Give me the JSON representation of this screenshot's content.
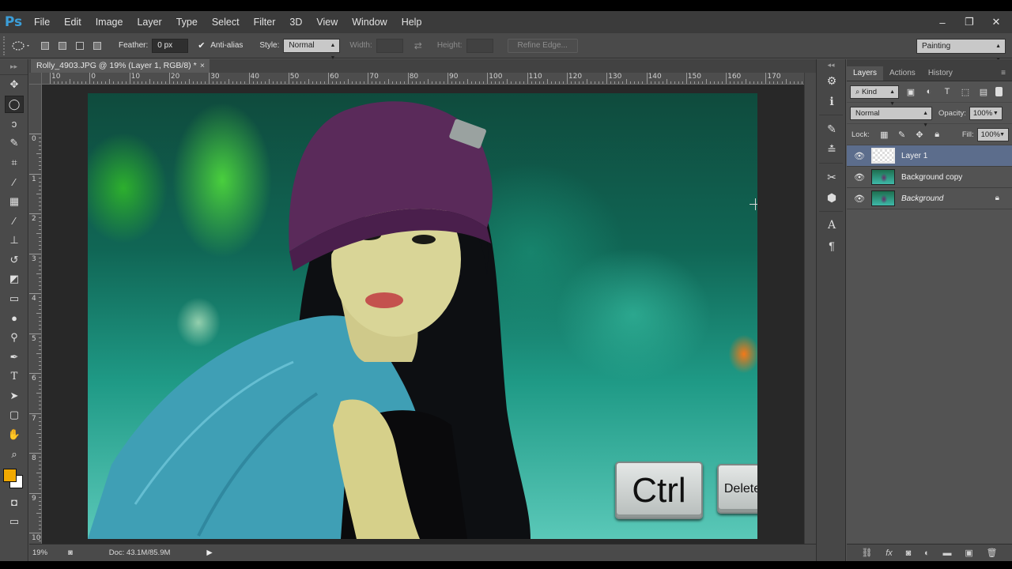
{
  "app": {
    "logo": "Ps",
    "menu": [
      "File",
      "Edit",
      "Image",
      "Layer",
      "Type",
      "Select",
      "Filter",
      "3D",
      "View",
      "Window",
      "Help"
    ],
    "window_buttons": [
      "–",
      "❐",
      "✕"
    ]
  },
  "options_bar": {
    "feather_label": "Feather:",
    "feather_value": "0 px",
    "antialias_label": "Anti-alias",
    "antialias_checked": true,
    "style_label": "Style:",
    "style_value": "Normal",
    "width_label": "Width:",
    "height_label": "Height:",
    "refine_edge_label": "Refine Edge...",
    "workspace_value": "Painting"
  },
  "document": {
    "tab_title": "Rolly_4903.JPG @ 19% (Layer 1, RGB/8) *",
    "tab_close": "×",
    "ruler_h_labels": [
      "10",
      "0",
      "10",
      "20",
      "30",
      "40",
      "50",
      "60",
      "70",
      "80",
      "90",
      "100",
      "110",
      "120",
      "130",
      "140",
      "150",
      "160",
      "170"
    ],
    "ruler_v_labels": [
      "0",
      "1",
      "2",
      "3",
      "4",
      "5",
      "6",
      "7",
      "8",
      "9",
      "10"
    ],
    "zoom": "19%",
    "doc_size": "Doc: 43.1M/85.9M"
  },
  "keys": {
    "ctrl": "Ctrl",
    "delete": "Delete"
  },
  "layers_panel": {
    "tabs": [
      "Layers",
      "Actions",
      "History"
    ],
    "kind_label": "Kind",
    "blend_mode": "Normal",
    "opacity_label": "Opacity:",
    "opacity_value": "100%",
    "lock_label": "Lock:",
    "fill_label": "Fill:",
    "fill_value": "100%",
    "layers": [
      {
        "name": "Layer 1",
        "selected": true,
        "thumb": "transparent",
        "locked": false
      },
      {
        "name": "Background copy",
        "selected": false,
        "thumb": "image",
        "locked": false
      },
      {
        "name": "Background",
        "selected": false,
        "thumb": "image",
        "locked": true
      }
    ],
    "footer_icons": [
      "link-icon",
      "fx-icon",
      "mask-icon",
      "adjustment-icon",
      "folder-icon",
      "new-layer-icon",
      "trash-icon"
    ]
  },
  "colors": {
    "foreground": "#f2a900",
    "background": "#ffffff",
    "selection_highlight": "#5c6d8c"
  }
}
